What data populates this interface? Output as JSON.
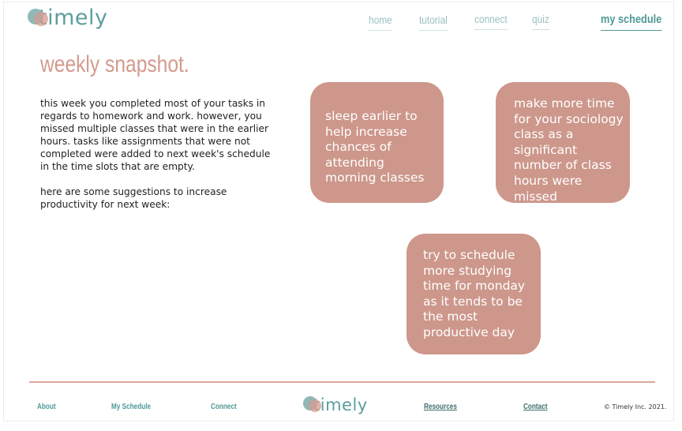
{
  "header": {
    "logo_text": "timely",
    "nav": {
      "home": "home",
      "tutorial": "tutorial",
      "connect": "connect",
      "quiz": "quiz",
      "my_schedule": "my schedule"
    }
  },
  "main": {
    "title": "weekly snapshot.",
    "paragraph1": "this week you completed most of your tasks in regards to homework and work. however, you missed multiple classes that were in the earlier hours. tasks like assignments that were not completed were added to next week's schedule in the time slots that are empty.",
    "paragraph2": "here are some suggestions to increase productivity for next week:",
    "suggestions": [
      "sleep earlier to help increase chances of attending morning classes",
      "make more time for your sociology class as a significant number of class hours were missed",
      "try to schedule more studying time for monday as it tends to be the most productive day"
    ]
  },
  "footer": {
    "links": {
      "about": "About",
      "my_schedule": "My Schedule",
      "connect": "Connect",
      "resources": "Resources",
      "contact": "Contact"
    },
    "logo_text": "timely",
    "copyright": "© Timely Inc. 2021."
  },
  "colors": {
    "brand_teal": "#5d9e9d",
    "accent_pink": "#cd978b",
    "title_pink": "#d39a8e"
  }
}
